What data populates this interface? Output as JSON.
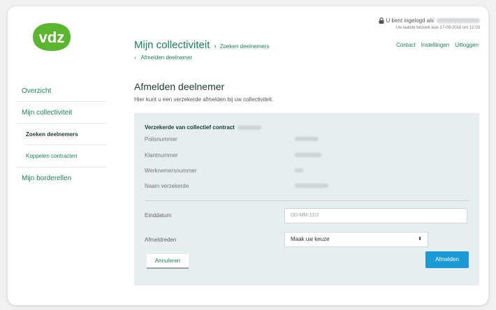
{
  "brand": {
    "logo_text": "vdz",
    "logo_color": "#5cb531",
    "accent": "#1a7e58",
    "button_blue": "#1d9ad6"
  },
  "header": {
    "title": "Mijn collectiviteit",
    "breadcrumb": [
      "Zoeken deelnemers",
      "Afmelden deelnemer"
    ],
    "login_text": "U bent ingelogd als",
    "last_visit": "Uw laatste bezoek was 17-09-2018 om 12:03",
    "links": [
      "Contact",
      "Instellingen",
      "Uitloggen"
    ]
  },
  "sidebar": {
    "items": [
      {
        "label": "Overzicht"
      },
      {
        "label": "Mijn collectiviteit"
      },
      {
        "label": "Zoeken deelnemers",
        "active": true
      },
      {
        "label": "Koppelen contracten"
      },
      {
        "label": "Mijn borderellen"
      }
    ]
  },
  "main": {
    "title": "Afmelden deelnemer",
    "subtitle": "Hier kunt u een verzekerde afmelden bij uw collectiviteit.",
    "panel_heading": "Verzekerde van collectief contract",
    "info_rows": [
      {
        "label": "Polisnummer"
      },
      {
        "label": "Klantnummer"
      },
      {
        "label": "Werknemersnummer"
      },
      {
        "label": "Naam verzekerde"
      }
    ],
    "form": {
      "end_date_label": "Einddatum",
      "end_date_placeholder": "DD-MM-JJJJ",
      "reason_label": "Afmeldreden",
      "reason_value": "Maak uw keuze",
      "cancel_label": "Annuleren",
      "submit_label": "Afmelden"
    }
  }
}
